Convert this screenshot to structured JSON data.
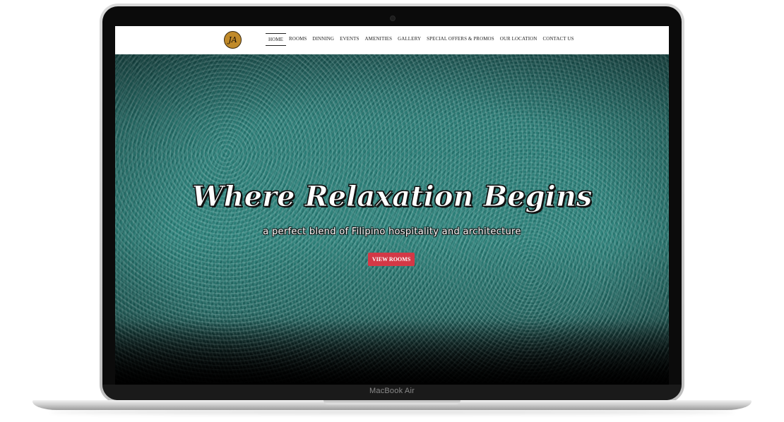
{
  "device": {
    "label": "MacBook Air"
  },
  "site": {
    "logo_text": "JA",
    "nav": [
      {
        "label": "HOME",
        "active": true
      },
      {
        "label": "ROOMS"
      },
      {
        "label": "DINNING"
      },
      {
        "label": "EVENTS"
      },
      {
        "label": "AMENITIES"
      },
      {
        "label": "GALLERY"
      },
      {
        "label": "SPECIAL OFFERS & PROMOS"
      },
      {
        "label": "OUR LOCATION"
      },
      {
        "label": "CONTACT US"
      }
    ],
    "hero": {
      "headline": "Where Relaxation Begins",
      "subheadline": "a perfect blend of Filipino hospitality and architecture",
      "cta_label": "VIEW ROOMS",
      "cta_color": "#d43846",
      "background_color": "#2a7a74"
    }
  }
}
